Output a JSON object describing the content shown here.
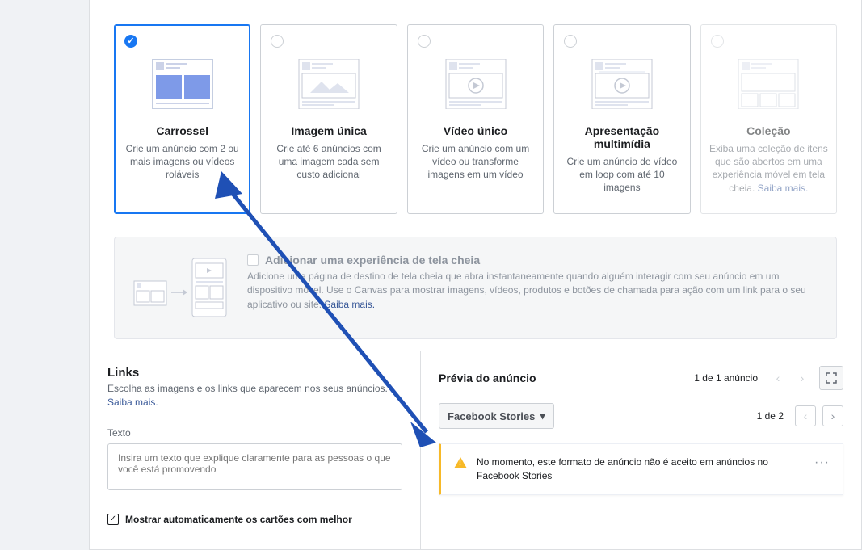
{
  "formats": [
    {
      "title": "Carrossel",
      "desc": "Crie um anúncio com 2 ou mais imagens ou vídeos roláveis",
      "selected": true
    },
    {
      "title": "Imagem única",
      "desc": "Crie até 6 anúncios com uma imagem cada sem custo adicional"
    },
    {
      "title": "Vídeo único",
      "desc": "Crie um anúncio com um vídeo ou transforme imagens em um vídeo"
    },
    {
      "title": "Apresentação multimídia",
      "desc": "Crie um anúncio de vídeo em loop com até 10 imagens"
    },
    {
      "title": "Coleção",
      "desc": "Exiba uma coleção de itens que são abertos em uma experiência móvel em tela cheia. ",
      "link": "Saiba mais.",
      "disabled": true
    }
  ],
  "fullscreen": {
    "title": "Adicionar uma experiência de tela cheia",
    "desc": "Adicione uma página de destino de tela cheia que abra instantaneamente quando alguém interagir com seu anúncio em um dispositivo móvel. Use o Canvas para mostrar imagens, vídeos, produtos e botões de chamada para ação com um link para o seu aplicativo ou site. ",
    "link": "Saiba mais."
  },
  "links": {
    "title": "Links",
    "sub": "Escolha as imagens e os links que aparecem nos seus anúncios. ",
    "link": "Saiba mais.",
    "texto_label": "Texto",
    "texto_placeholder": "Insira um texto que explique claramente para as pessoas o que você está promovendo",
    "mostrar_label": "Mostrar automaticamente os cartões com melhor"
  },
  "preview": {
    "title": "Prévia do anúncio",
    "count_top": "1 de 1 anúncio",
    "placement": "Facebook Stories",
    "count_bottom": "1 de 2",
    "warning_text": "No momento, este formato de anúncio não é aceito em anúncios no Facebook Stories"
  }
}
